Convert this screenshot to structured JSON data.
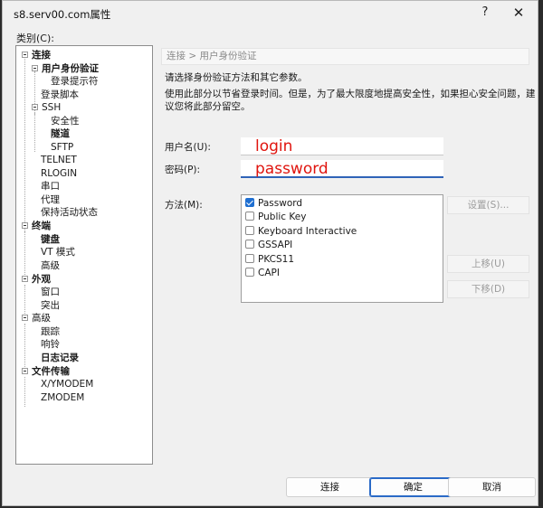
{
  "window": {
    "title": "s8.serv00.com属性",
    "help_label": "?",
    "close_label": "✕"
  },
  "category": {
    "label": "类别(C):"
  },
  "tree": [
    {
      "label": "连接",
      "bold": true
    },
    {
      "label": "用户身份验证",
      "bold": true
    },
    {
      "label": "登录提示符",
      "bold": false
    },
    {
      "label": "登录脚本",
      "bold": false
    },
    {
      "label": "SSH",
      "bold": false
    },
    {
      "label": "安全性",
      "bold": false
    },
    {
      "label": "隧道",
      "bold": true
    },
    {
      "label": "SFTP",
      "bold": false
    },
    {
      "label": "TELNET",
      "bold": false
    },
    {
      "label": "RLOGIN",
      "bold": false
    },
    {
      "label": "串口",
      "bold": false
    },
    {
      "label": "代理",
      "bold": false
    },
    {
      "label": "保持活动状态",
      "bold": false
    },
    {
      "label": "终端",
      "bold": true
    },
    {
      "label": "键盘",
      "bold": true
    },
    {
      "label": "VT 模式",
      "bold": false
    },
    {
      "label": "高级",
      "bold": false
    },
    {
      "label": "外观",
      "bold": true
    },
    {
      "label": "窗口",
      "bold": false
    },
    {
      "label": "突出",
      "bold": false
    },
    {
      "label": "高级",
      "bold": false
    },
    {
      "label": "跟踪",
      "bold": false
    },
    {
      "label": "响铃",
      "bold": false
    },
    {
      "label": "日志记录",
      "bold": true
    },
    {
      "label": "文件传输",
      "bold": true
    },
    {
      "label": "X/YMODEM",
      "bold": false
    },
    {
      "label": "ZMODEM",
      "bold": false
    }
  ],
  "breadcrumb": "连接 > 用户身份验证",
  "description": {
    "line1": "请选择身份验证方法和其它参数。",
    "line2": "使用此部分以节省登录时间。但是，为了最大限度地提高安全性，如果担心安全问题，建",
    "line3": "议您将此部分留空。"
  },
  "username": {
    "label": "用户名(U):",
    "value": "login"
  },
  "password": {
    "label": "密码(P):",
    "value": "password"
  },
  "method": {
    "label": "方法(M):",
    "options": [
      {
        "label": "Password",
        "checked": true
      },
      {
        "label": "Public Key",
        "checked": false
      },
      {
        "label": "Keyboard Interactive",
        "checked": false
      },
      {
        "label": "GSSAPI",
        "checked": false
      },
      {
        "label": "PKCS11",
        "checked": false
      },
      {
        "label": "CAPI",
        "checked": false
      }
    ]
  },
  "side_buttons": {
    "settings": "设置(S)...",
    "move_up": "上移(U)",
    "move_down": "下移(D)"
  },
  "footer": {
    "connect": "连接",
    "ok": "确定",
    "cancel": "取消"
  }
}
